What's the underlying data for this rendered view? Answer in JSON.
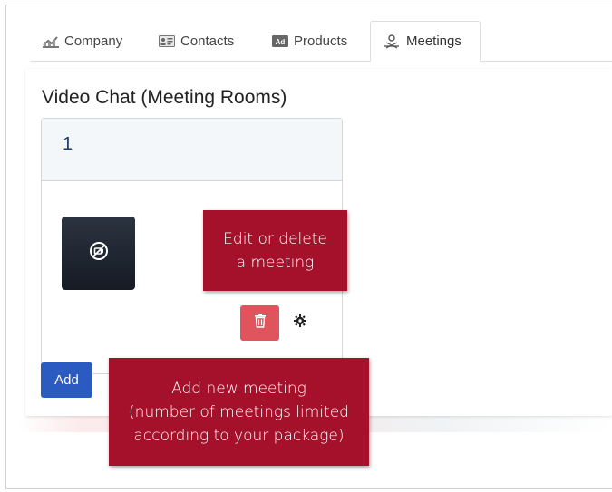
{
  "tabs": [
    {
      "label": "Company",
      "icon": "chart-icon"
    },
    {
      "label": "Contacts",
      "icon": "contact-card-icon"
    },
    {
      "label": "Products",
      "icon": "ad-badge-icon"
    },
    {
      "label": "Meetings",
      "icon": "meeting-icon",
      "active": true
    }
  ],
  "page": {
    "title": "Video Chat (Meeting Rooms)"
  },
  "meeting_card": {
    "number": "1",
    "thumbnail_icon": "camera-off-icon",
    "delete_icon": "trash-icon",
    "settings_icon": "gear-icon"
  },
  "add_button": {
    "label": "Add"
  },
  "callouts": {
    "edit": {
      "line1": "Edit or delete",
      "line2": "a meeting"
    },
    "add": {
      "line1": "Add new meeting",
      "line2": "(number of meetings limited",
      "line3": "according to your package)"
    }
  },
  "colors": {
    "accent_blue": "#2b5ac0",
    "delete_red": "#e0545d",
    "callout_red": "#a5102a",
    "number_navy": "#1f3a6a"
  }
}
